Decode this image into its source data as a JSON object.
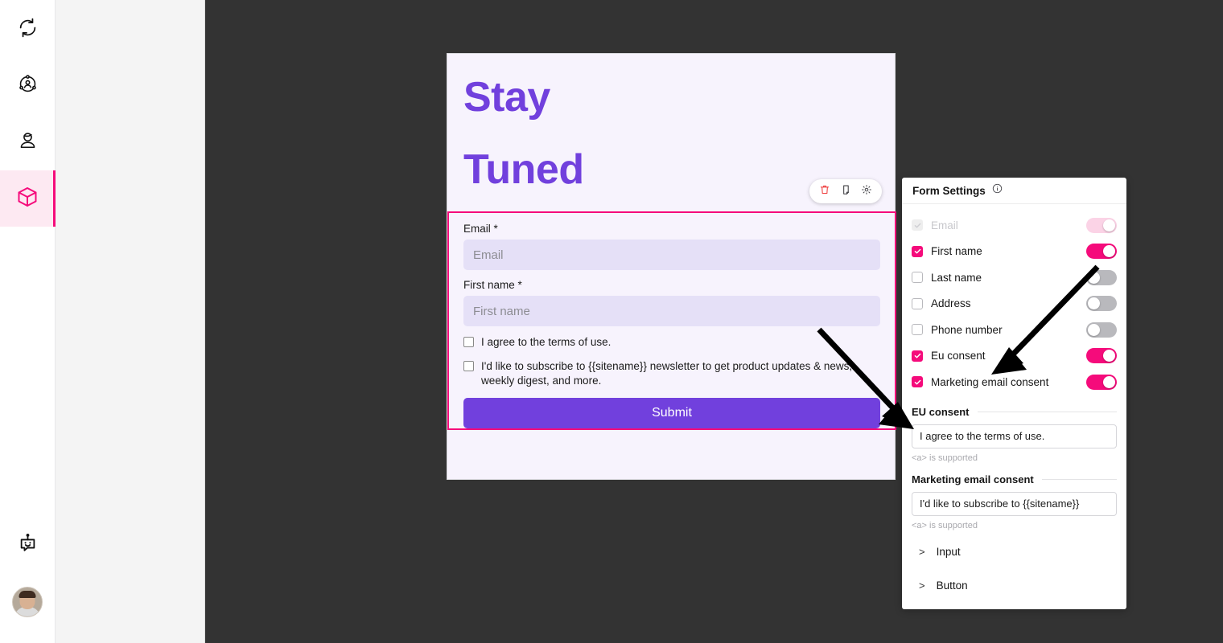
{
  "rail": {
    "items": [
      {
        "name": "sync-icon",
        "label": "Sync"
      },
      {
        "name": "audience-icon",
        "label": "Audience"
      },
      {
        "name": "persona-icon",
        "label": "Persona"
      },
      {
        "name": "cube-icon",
        "label": "Blocks"
      }
    ],
    "bottom": [
      {
        "name": "bot-icon",
        "label": "Assistant"
      },
      {
        "name": "avatar",
        "label": "Account"
      }
    ]
  },
  "canvas": {
    "hero": {
      "line1": "Stay",
      "line2": "Tuned"
    },
    "element_toolbar": {
      "delete_label": "Delete",
      "duplicate_label": "Duplicate",
      "settings_label": "Settings"
    },
    "form": {
      "email_label": "Email *",
      "email_placeholder": "Email",
      "first_name_label": "First name *",
      "first_name_placeholder": "First name",
      "consent_text": "I agree to the terms of use.",
      "marketing_text": "I'd like to subscribe to {{sitename}} newsletter to get product updates & news, weekly digest, and more.",
      "submit_label": "Submit"
    }
  },
  "settings": {
    "title": "Form Settings",
    "info_label": "Info",
    "fields": [
      {
        "label": "Email",
        "checked": true,
        "disabled": true,
        "toggle": "faded"
      },
      {
        "label": "First name",
        "checked": true,
        "disabled": false,
        "toggle": "on"
      },
      {
        "label": "Last name",
        "checked": false,
        "disabled": false,
        "toggle": "off"
      },
      {
        "label": "Address",
        "checked": false,
        "disabled": false,
        "toggle": "off"
      },
      {
        "label": "Phone number",
        "checked": false,
        "disabled": false,
        "toggle": "off"
      },
      {
        "label": "Eu consent",
        "checked": true,
        "disabled": false,
        "toggle": "on"
      },
      {
        "label": "Marketing email consent",
        "checked": true,
        "disabled": false,
        "toggle": "on"
      }
    ],
    "sections": [
      {
        "title": "EU consent",
        "value": "I agree to the terms of use.",
        "hint": "<a> is supported"
      },
      {
        "title": "Marketing email consent",
        "value": "I'd like to subscribe to {{sitename}}",
        "hint": "<a> is supported"
      }
    ],
    "collapsed": [
      {
        "label": "Input",
        "chevron": ">"
      },
      {
        "label": "Button",
        "chevron": ">"
      }
    ]
  },
  "colors": {
    "accent_pink": "#f50b7b",
    "accent_purple": "#7140dd",
    "canvas_bg": "#333333",
    "page_bg": "#f7f3fd",
    "input_bg": "#e5e0f7",
    "panel_gray": "#f4f4f4"
  }
}
